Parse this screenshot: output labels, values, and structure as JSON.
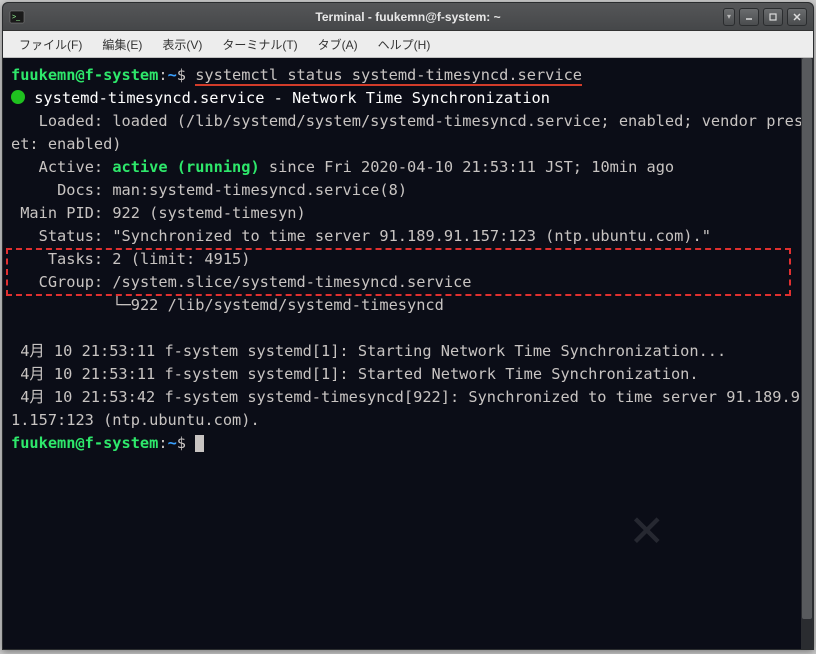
{
  "window": {
    "title": "Terminal - fuukemn@f-system: ~"
  },
  "menubar": {
    "items": [
      "ファイル(F)",
      "編集(E)",
      "表示(V)",
      "ターミナル(T)",
      "タブ(A)",
      "ヘルプ(H)"
    ]
  },
  "prompt": {
    "user": "fuukemn@f-system",
    "sep1": ":",
    "path": "~",
    "sep2": "$ "
  },
  "command": "systemctl status systemd-timesyncd.service",
  "output": {
    "line1_service": "systemd-timesyncd.service - Network Time Synchronization",
    "loaded": "   Loaded: loaded (/lib/systemd/system/systemd-timesyncd.service; enabled; vendor preset: enabled)",
    "active_pre": "   Active: ",
    "active_status": "active (running)",
    "active_post": " since Fri 2020-04-10 21:53:11 JST; 10min ago",
    "docs": "     Docs: man:systemd-timesyncd.service(8)",
    "mainpid": " Main PID: 922 (systemd-timesyn)",
    "status": "   Status: \"Synchronized to time server 91.189.91.157:123 (ntp.ubuntu.com).\"",
    "tasks": "    Tasks: 2 (limit: 4915)",
    "cgroup1": "   CGroup: /system.slice/systemd-timesyncd.service",
    "cgroup2": "           └─922 /lib/systemd/systemd-timesyncd",
    "blank1": "",
    "log1": " 4月 10 21:53:11 f-system systemd[1]: Starting Network Time Synchronization...",
    "log2": " 4月 10 21:53:11 f-system systemd[1]: Started Network Time Synchronization.",
    "log3": " 4月 10 21:53:42 f-system systemd-timesyncd[922]: Synchronized to time server 91.189.91.157:123 (ntp.ubuntu.com)."
  },
  "watermark": "✕"
}
